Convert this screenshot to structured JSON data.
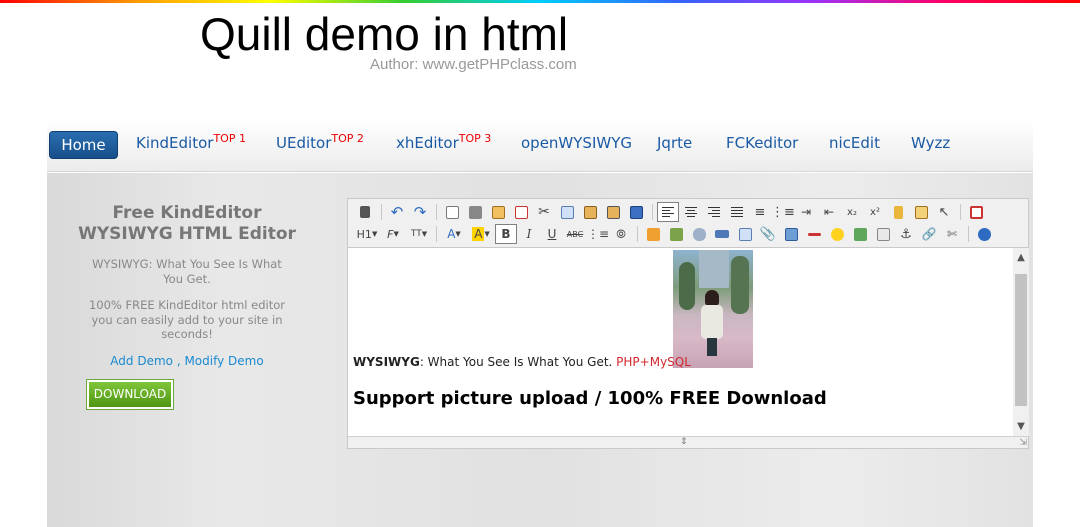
{
  "page": {
    "title": "Quill demo in html",
    "author": "Author: www.getPHPclass.com"
  },
  "nav": {
    "items": [
      {
        "label": "Home",
        "sup": ""
      },
      {
        "label": "KindEditor",
        "sup": "TOP 1"
      },
      {
        "label": "UEditor",
        "sup": "TOP 2"
      },
      {
        "label": "xhEditor",
        "sup": "TOP 3"
      },
      {
        "label": "openWYSIWYG",
        "sup": ""
      },
      {
        "label": "Jqrte",
        "sup": ""
      },
      {
        "label": "FCKeditor",
        "sup": ""
      },
      {
        "label": "nicEdit",
        "sup": ""
      },
      {
        "label": "Wyzz",
        "sup": ""
      }
    ]
  },
  "sidebar": {
    "heading_line1": "Free KindEditor",
    "heading_line2": "WYSIWYG HTML Editor",
    "desc1": "WYSIWYG: What You See Is What You Get.",
    "desc2": "100% FREE KindEditor html editor you can easily add to your site in seconds!",
    "add_demo": "Add Demo",
    "link_sep": " , ",
    "modify_demo": "Modify Demo",
    "download": "DOWNLOAD"
  },
  "editor": {
    "toolbar": {
      "heading_select": "H1",
      "font_select": "F",
      "size_select": "TT"
    },
    "content": {
      "bold_term": "WYSIWYG",
      "sentence": ": What You See Is What You Get. ",
      "highlight": "PHP+MySQL",
      "headline": "Support picture upload / 100% FREE Download"
    }
  },
  "colors": {
    "nav_link": "#1a5aa5",
    "nav_sup": "#ee0000",
    "home_bg": "#1f5f9e",
    "download_bg": "#5fa81f",
    "side_link": "#1a8ad0",
    "highlight_text": "#d0282e"
  }
}
